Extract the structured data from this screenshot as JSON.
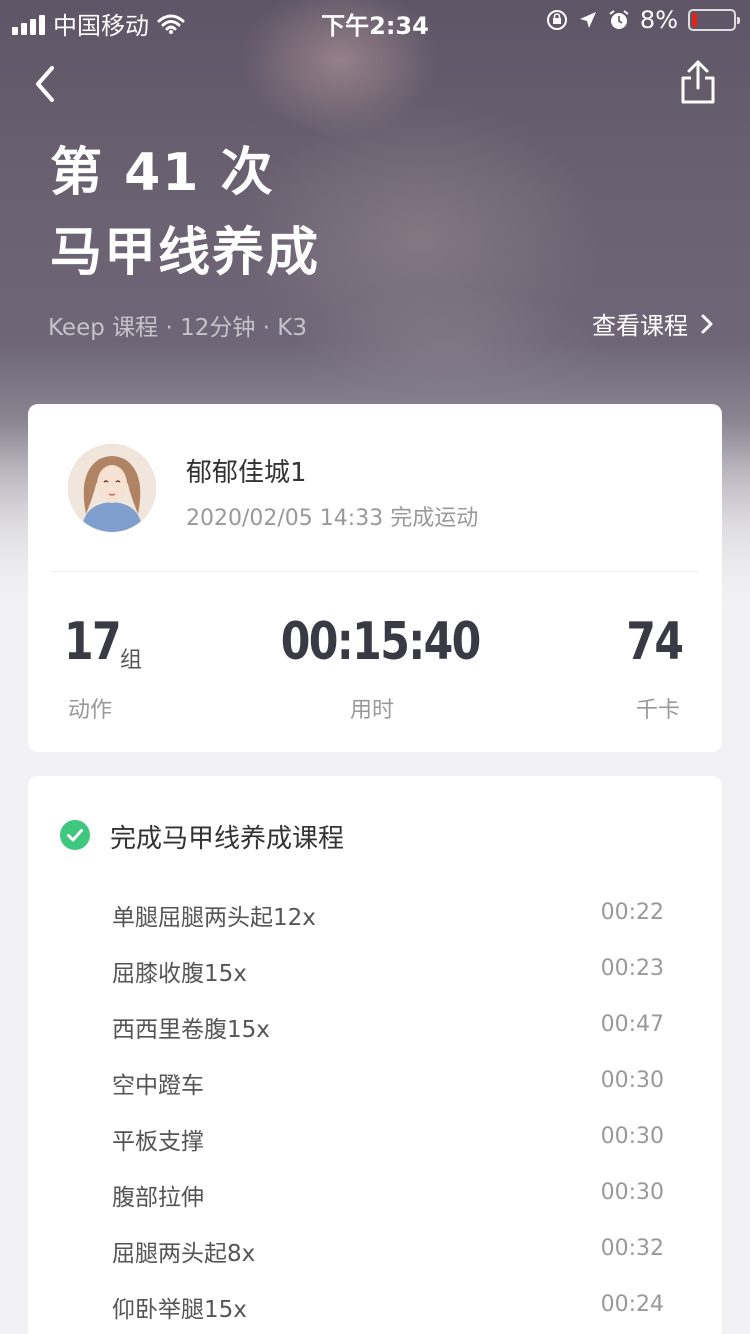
{
  "status_bar": {
    "carrier": "中国移动",
    "time": "下午2:34",
    "battery": "8%",
    "battery_level": 0.08
  },
  "header": {
    "title_line1": "第 41 次",
    "title_line2": "马甲线养成",
    "subline": "Keep 课程 · 12分钟 · K3",
    "view_course": "查看课程"
  },
  "profile": {
    "username": "郁郁佳城1",
    "finish_time": "2020/02/05 14:33 完成运动"
  },
  "stats": {
    "actions_value": "17",
    "actions_unit": "组",
    "actions_label": "动作",
    "duration_value": "00:15:40",
    "duration_label": "用时",
    "calories_value": "74",
    "calories_label": "千卡"
  },
  "course": {
    "title": "完成马甲线养成课程",
    "accent": "#3fc77f",
    "exercises": [
      {
        "name": "单腿屈腿两头起12x",
        "duration": "00:22"
      },
      {
        "name": "屈膝收腹15x",
        "duration": "00:23"
      },
      {
        "name": "西西里卷腹15x",
        "duration": "00:47"
      },
      {
        "name": "空中蹬车",
        "duration": "00:30"
      },
      {
        "name": "平板支撑",
        "duration": "00:30"
      },
      {
        "name": "腹部拉伸",
        "duration": "00:30"
      },
      {
        "name": "屈腿两头起8x",
        "duration": "00:32"
      },
      {
        "name": "仰卧举腿15x",
        "duration": "00:24"
      }
    ]
  },
  "icons": {
    "back": "chevron-left-icon",
    "share": "share-icon",
    "view_course_arrow": "chevron-right-icon",
    "complete": "check-circle-icon"
  }
}
